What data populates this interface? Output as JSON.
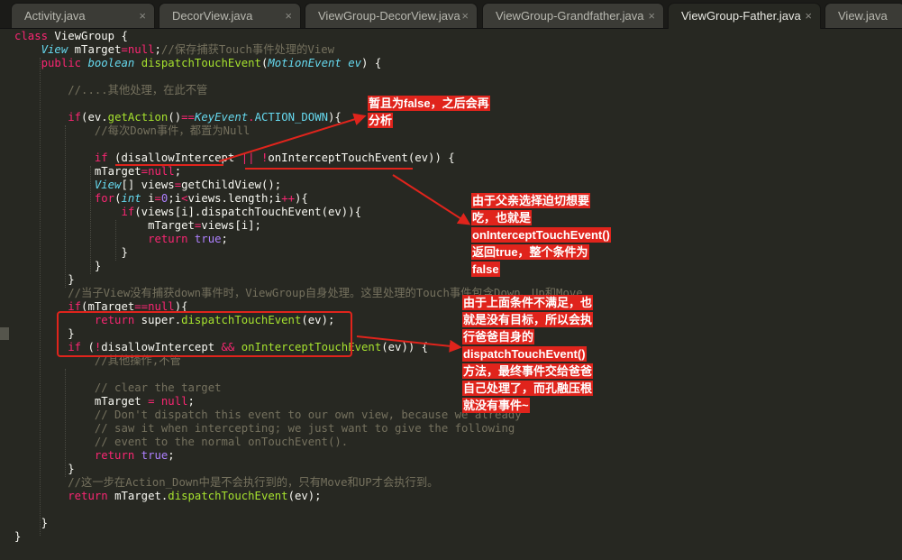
{
  "tabs": [
    {
      "label": "Activity.java",
      "active": false,
      "close_icon": "×"
    },
    {
      "label": "DecorView.java",
      "active": false,
      "close_icon": "×"
    },
    {
      "label": "ViewGroup-DecorView.java",
      "active": false,
      "close_icon": "×"
    },
    {
      "label": "ViewGroup-Grandfather.java",
      "active": false,
      "close_icon": "×"
    },
    {
      "label": "ViewGroup-Father.java",
      "active": true,
      "close_icon": "×"
    },
    {
      "label": "View.java",
      "active": false,
      "close_icon": ""
    }
  ],
  "code": {
    "lines": [
      [
        [
          "kw",
          "class "
        ],
        [
          "pl",
          "ViewGroup {"
        ]
      ],
      [
        [
          "pl",
          "    "
        ],
        [
          "ty",
          "View"
        ],
        [
          "pl",
          " mTarget"
        ],
        [
          "kw",
          "="
        ],
        [
          "kw",
          "null"
        ],
        [
          "pl",
          ";"
        ],
        [
          "cm",
          "//保存捕获Touch事件处理的View"
        ]
      ],
      [
        [
          "pl",
          "    "
        ],
        [
          "kw",
          "public "
        ],
        [
          "ty",
          "boolean "
        ],
        [
          "fn",
          "dispatchTouchEvent"
        ],
        [
          "pl",
          "("
        ],
        [
          "ty",
          "MotionEvent"
        ],
        [
          "pl",
          " "
        ],
        [
          "ty",
          "ev"
        ],
        [
          "pl",
          ") {"
        ]
      ],
      [],
      [
        [
          "pl",
          "        "
        ],
        [
          "cm",
          "//....其他处理，在此不管"
        ]
      ],
      [],
      [
        [
          "pl",
          "        "
        ],
        [
          "kw",
          "if"
        ],
        [
          "pl",
          "(ev."
        ],
        [
          "fn",
          "getAction"
        ],
        [
          "pl",
          "()"
        ],
        [
          "kw",
          "=="
        ],
        [
          "ty",
          "KeyEvent"
        ],
        [
          "kw",
          "."
        ],
        [
          "ty2",
          "ACTION_DOWN"
        ],
        [
          "pl",
          "){"
        ]
      ],
      [
        [
          "pl",
          "            "
        ],
        [
          "cm",
          "//每次Down事件，都置为Null"
        ]
      ],
      [],
      [
        [
          "pl",
          "            "
        ],
        [
          "kw",
          "if"
        ],
        [
          "pl",
          " (disallowIntercept "
        ],
        [
          "kw",
          "||"
        ],
        [
          "pl",
          " "
        ],
        [
          "kw",
          "!"
        ],
        [
          "pl",
          "onInterceptTouchEvent(ev)) {"
        ]
      ],
      [
        [
          "pl",
          "            mTarget"
        ],
        [
          "kw",
          "="
        ],
        [
          "kw",
          "null"
        ],
        [
          "pl",
          ";"
        ]
      ],
      [
        [
          "pl",
          "            "
        ],
        [
          "ty",
          "View"
        ],
        [
          "pl",
          "[] views"
        ],
        [
          "kw",
          "="
        ],
        [
          "pl",
          "getChildView();"
        ]
      ],
      [
        [
          "pl",
          "            "
        ],
        [
          "kw",
          "for"
        ],
        [
          "pl",
          "("
        ],
        [
          "ty",
          "int"
        ],
        [
          "pl",
          " i"
        ],
        [
          "kw",
          "="
        ],
        [
          "num",
          "0"
        ],
        [
          "pl",
          ";i"
        ],
        [
          "kw",
          "<"
        ],
        [
          "pl",
          "views.length;i"
        ],
        [
          "kw",
          "++"
        ],
        [
          "pl",
          "){"
        ]
      ],
      [
        [
          "pl",
          "                "
        ],
        [
          "kw",
          "if"
        ],
        [
          "pl",
          "(views[i].dispatchTouchEvent(ev)){"
        ]
      ],
      [
        [
          "pl",
          "                    mTarget"
        ],
        [
          "kw",
          "="
        ],
        [
          "pl",
          "views[i];"
        ]
      ],
      [
        [
          "pl",
          "                    "
        ],
        [
          "kw",
          "return "
        ],
        [
          "num",
          "true"
        ],
        [
          "pl",
          ";"
        ]
      ],
      [
        [
          "pl",
          "                }"
        ]
      ],
      [
        [
          "pl",
          "            }"
        ]
      ],
      [
        [
          "pl",
          "        }"
        ]
      ],
      [
        [
          "pl",
          "        "
        ],
        [
          "cm",
          "//当子View没有捕获down事件时，ViewGroup自身处理。这里处理的Touch事件包含Down、Up和Move"
        ]
      ],
      [
        [
          "pl",
          "        "
        ],
        [
          "kw",
          "if"
        ],
        [
          "pl",
          "(mTarget"
        ],
        [
          "kw",
          "=="
        ],
        [
          "kw",
          "null"
        ],
        [
          "pl",
          "){"
        ]
      ],
      [
        [
          "pl",
          "            "
        ],
        [
          "kw",
          "return "
        ],
        [
          "pl",
          "super."
        ],
        [
          "fn",
          "dispatchTouchEvent"
        ],
        [
          "pl",
          "(ev);"
        ]
      ],
      [
        [
          "pl",
          "        }"
        ]
      ],
      [
        [
          "pl",
          "        "
        ],
        [
          "kw",
          "if"
        ],
        [
          "pl",
          " ("
        ],
        [
          "kw",
          "!"
        ],
        [
          "pl",
          "disallowIntercept "
        ],
        [
          "kw",
          "&&"
        ],
        [
          "pl",
          " "
        ],
        [
          "fn",
          "onInterceptTouchEvent"
        ],
        [
          "pl",
          "(ev)) {"
        ]
      ],
      [
        [
          "pl",
          "            "
        ],
        [
          "cm",
          "//其他操作,不管"
        ]
      ],
      [],
      [
        [
          "pl",
          "            "
        ],
        [
          "cm",
          "// clear the target"
        ]
      ],
      [
        [
          "pl",
          "            mTarget "
        ],
        [
          "kw",
          "="
        ],
        [
          "pl",
          " "
        ],
        [
          "kw",
          "null"
        ],
        [
          "pl",
          ";"
        ]
      ],
      [
        [
          "pl",
          "            "
        ],
        [
          "cm",
          "// Don't dispatch this event to our own view, because we already"
        ]
      ],
      [
        [
          "pl",
          "            "
        ],
        [
          "cm",
          "// saw it when intercepting; we just want to give the following"
        ]
      ],
      [
        [
          "pl",
          "            "
        ],
        [
          "cm",
          "// event to the normal onTouchEvent()."
        ]
      ],
      [
        [
          "pl",
          "            "
        ],
        [
          "kw",
          "return "
        ],
        [
          "num",
          "true"
        ],
        [
          "pl",
          ";"
        ]
      ],
      [
        [
          "pl",
          "        }"
        ]
      ],
      [
        [
          "pl",
          "        "
        ],
        [
          "cm",
          "//这一步在Action_Down中是不会执行到的，只有Move和UP才会执行到。"
        ]
      ],
      [
        [
          "pl",
          "        "
        ],
        [
          "kw",
          "return "
        ],
        [
          "pl",
          "mTarget."
        ],
        [
          "fn",
          "dispatchTouchEvent"
        ],
        [
          "pl",
          "(ev);"
        ]
      ],
      [],
      [
        [
          "pl",
          "    }"
        ]
      ],
      [
        [
          "pl",
          "}"
        ]
      ]
    ]
  },
  "annotations": {
    "note1": "暂且为false，之后会再分析",
    "note2": "由于父亲选择迫切想要吃，也就是onInterceptTouchEvent()返回true，整个条件为false",
    "note3": "由于上面条件不满足，也就是没有目标，所以会执行爸爸自身的dispatchTouchEvent()方法，最终事件交给爸爸自己处理了，而孔融压根就没有事件~"
  },
  "colors": {
    "background": "#272822",
    "annotation": "#e0241c",
    "keyword": "#f92672",
    "type": "#66d9ef",
    "function": "#a6e22e",
    "number": "#ae81ff",
    "comment": "#75715e"
  }
}
